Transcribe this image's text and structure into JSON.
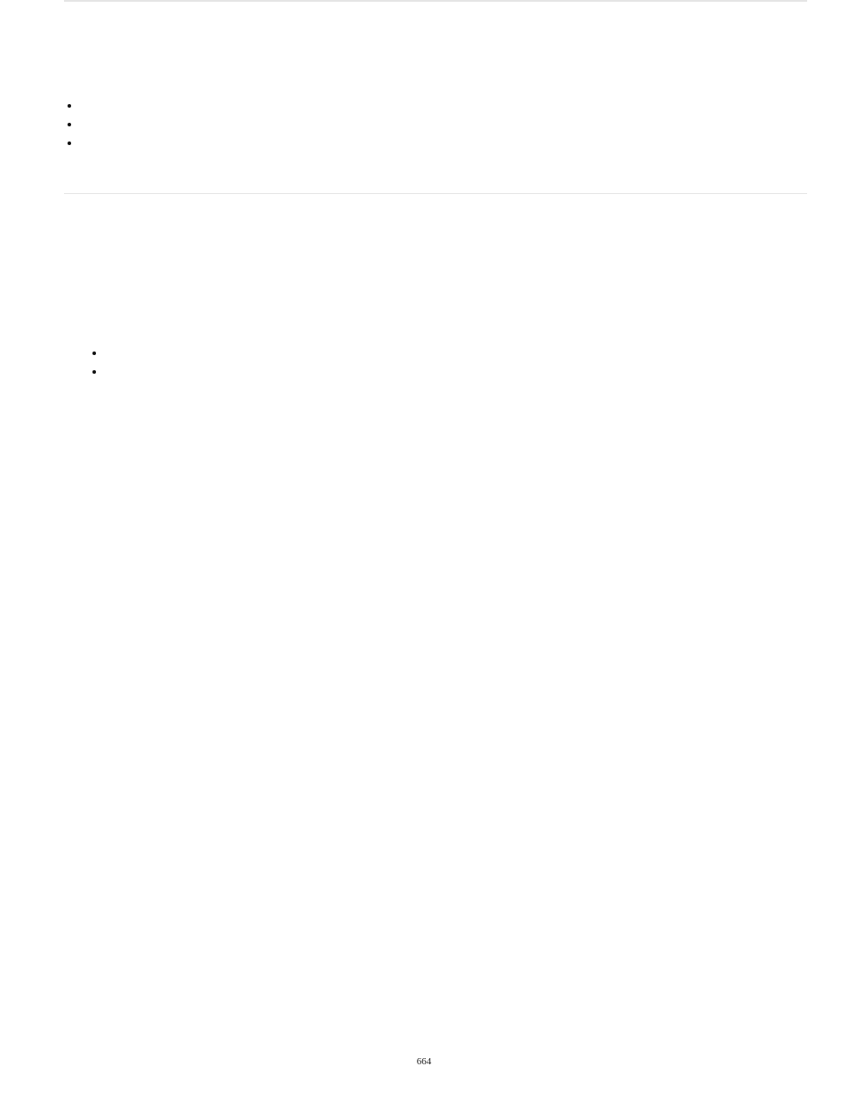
{
  "lists": {
    "a": [
      "",
      "",
      ""
    ],
    "b": [
      "",
      ""
    ]
  },
  "page_number": "664"
}
